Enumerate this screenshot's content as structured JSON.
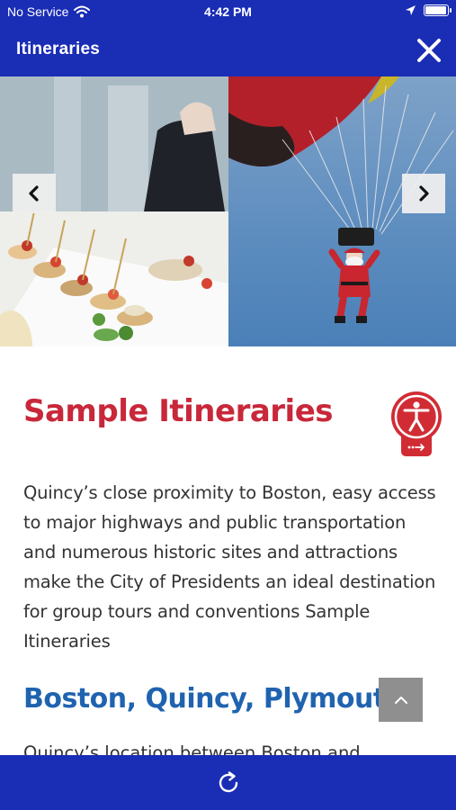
{
  "status_bar": {
    "carrier": "No Service",
    "time": "4:42 PM",
    "battery_level": 0.9,
    "icons": [
      "wifi-icon",
      "location-arrow-icon",
      "battery-icon"
    ]
  },
  "header": {
    "title": "Itineraries",
    "close_icon": "close-icon"
  },
  "carousel": {
    "slides": [
      "food-platter-image",
      "parachuting-santa-image"
    ],
    "prev_icon": "chevron-left-icon",
    "next_icon": "chevron-right-icon"
  },
  "content": {
    "title": "Sample Itineraries",
    "paragraph": "Quincy’s close proximity to Boston, easy access to major highways and public transportation and numerous historic sites and attractions make the City of Presidents an ideal destination for group tours and conventions Sample Itineraries",
    "subtitle": "Boston, Quincy, Plymouth:",
    "partial_text": "Quincy’s location between Boston and",
    "accessibility_icon": "accessibility-icon",
    "scroll_top_icon": "chevron-up-icon"
  },
  "bottom_bar": {
    "refresh_icon": "refresh-icon"
  },
  "colors": {
    "brand_blue": "#1a2db5",
    "title_red": "#c8283a",
    "subtitle_blue": "#1f63b0",
    "text": "#333333"
  }
}
